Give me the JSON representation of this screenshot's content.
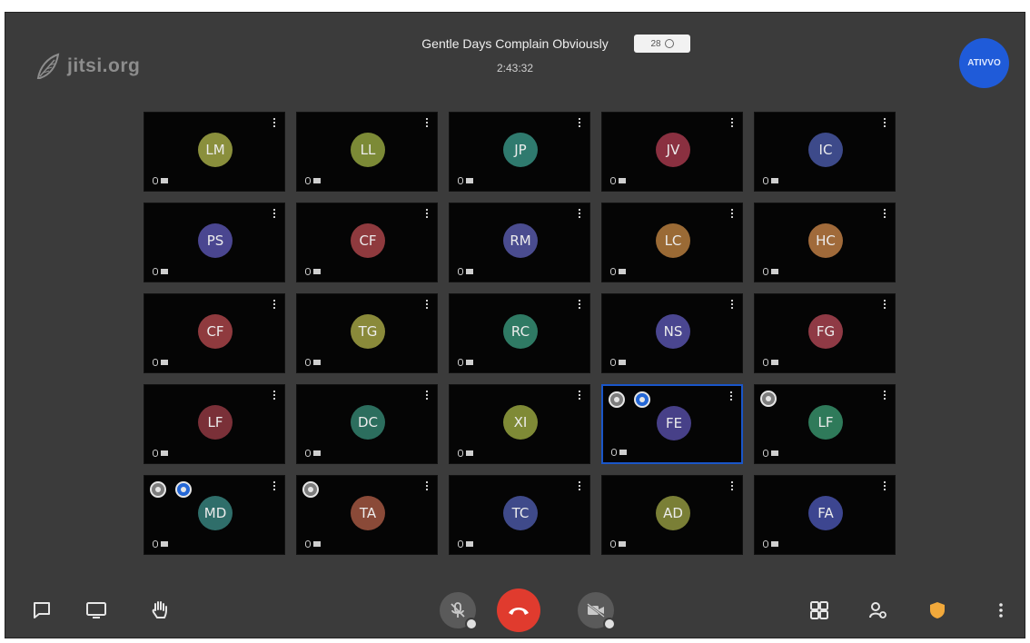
{
  "header": {
    "logo_text": "jitsi.org",
    "meeting_title": "Gentle Days Complain Obviously",
    "timer": "2:43:32",
    "participant_count": "28",
    "user_avatar_text": "ATIVVO",
    "user_avatar_color": "#1f5bd9"
  },
  "participants": [
    {
      "initials": "LM",
      "color": "#8a8f3c",
      "indicators": []
    },
    {
      "initials": "LL",
      "color": "#7c8a36",
      "indicators": []
    },
    {
      "initials": "JP",
      "color": "#2f7a6e",
      "indicators": []
    },
    {
      "initials": "JV",
      "color": "#8a3040",
      "indicators": []
    },
    {
      "initials": "IC",
      "color": "#3d4a8a",
      "indicators": []
    },
    {
      "initials": "PS",
      "color": "#4a4690",
      "indicators": []
    },
    {
      "initials": "CF",
      "color": "#8f3a3e",
      "indicators": []
    },
    {
      "initials": "RM",
      "color": "#4a4c8f",
      "indicators": []
    },
    {
      "initials": "LC",
      "color": "#9a6a35",
      "indicators": []
    },
    {
      "initials": "HC",
      "color": "#a06a3a",
      "indicators": []
    },
    {
      "initials": "CF",
      "color": "#8f3a3e",
      "indicators": []
    },
    {
      "initials": "TG",
      "color": "#8a8a3a",
      "indicators": []
    },
    {
      "initials": "RC",
      "color": "#2f7a64",
      "indicators": []
    },
    {
      "initials": "NS",
      "color": "#4a4690",
      "indicators": []
    },
    {
      "initials": "FG",
      "color": "#8f3a45",
      "indicators": []
    },
    {
      "initials": "LF",
      "color": "#7a3038",
      "indicators": []
    },
    {
      "initials": "DC",
      "color": "#2c6e5e",
      "indicators": []
    },
    {
      "initials": "XI",
      "color": "#7f8a36",
      "indicators": []
    },
    {
      "initials": "FE",
      "color": "#474088",
      "indicators": [
        "grey",
        "blue"
      ],
      "active": true
    },
    {
      "initials": "LF",
      "color": "#2f7a5a",
      "indicators": [
        "grey"
      ]
    },
    {
      "initials": "MD",
      "color": "#2f6e6a",
      "indicators": [
        "grey",
        "blue"
      ]
    },
    {
      "initials": "TA",
      "color": "#8a4a38",
      "indicators": [
        "grey"
      ]
    },
    {
      "initials": "TC",
      "color": "#3f4a8a",
      "indicators": []
    },
    {
      "initials": "AD",
      "color": "#7a7f36",
      "indicators": []
    },
    {
      "initials": "FA",
      "color": "#3d4690",
      "indicators": []
    }
  ],
  "toolbar": {
    "items_left": [
      "chat-icon",
      "screenshare-icon",
      "raise-hand-icon"
    ],
    "items_center": [
      "mic-muted-icon",
      "hangup-icon",
      "camera-off-icon"
    ],
    "items_right": [
      "tile-view-icon",
      "participants-icon",
      "security-shield-icon",
      "more-icon"
    ],
    "hangup_color": "#e03b2e",
    "shield_color": "#f2a93b"
  }
}
